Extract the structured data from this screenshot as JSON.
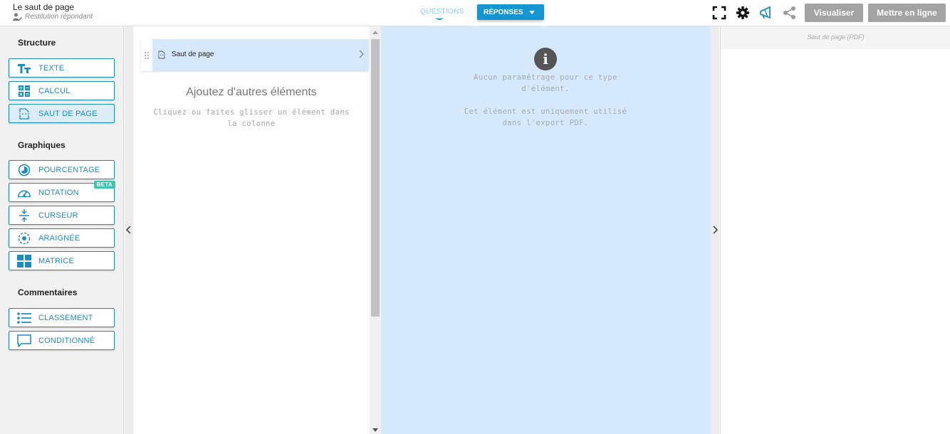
{
  "header": {
    "doc_title": "Le saut de page",
    "doc_subtitle": "Restitution répondant",
    "tab_questions": "QUESTIONS",
    "tab_reponses": "RÉPONSES",
    "visualiser": "Visualiser",
    "mettre_en_ligne": "Mettre en ligne",
    "icons": [
      "fullscreen-icon",
      "gear-icon",
      "campaign-icon",
      "share-icon"
    ]
  },
  "sidebar": {
    "structure_title": "Structure",
    "structure_items": [
      {
        "label": "TEXTE",
        "icon": "text-icon"
      },
      {
        "label": "CALCUL",
        "icon": "calculator-icon"
      },
      {
        "label": "SAUT DE PAGE",
        "icon": "page-break-icon",
        "active": true
      }
    ],
    "graphiques_title": "Graphiques",
    "graphiques_items": [
      {
        "label": "POURCENTAGE",
        "icon": "pie-icon"
      },
      {
        "label": "NOTATION",
        "icon": "gauge-icon",
        "badge": "BETA"
      },
      {
        "label": "CURSEUR",
        "icon": "slider-icon"
      },
      {
        "label": "ARAIGNÉE",
        "icon": "spider-icon"
      },
      {
        "label": "MATRICE",
        "icon": "matrix-icon"
      }
    ],
    "commentaires_title": "Commentaires",
    "commentaires_items": [
      {
        "label": "CLASSEMENT",
        "icon": "list-icon"
      },
      {
        "label": "CONDITIONNÉ",
        "icon": "comment-icon"
      }
    ]
  },
  "column": {
    "item_label": "Saut de page",
    "add_title": "Ajoutez d'autres éléments",
    "add_desc": "Cliquez ou faites glisser un élément dans la colonne"
  },
  "settings": {
    "info_line1": "Aucun paramétrage pour ce type d'élément.",
    "info_line2": "Cet élément est uniquement utilisé dans l'export PDF."
  },
  "preview": {
    "header": "Saut de page (PDF)"
  },
  "colors": {
    "accent": "#1d8cc2",
    "button_blue": "#1596d2",
    "settings_bg": "#d6e8fb",
    "beta": "#3cc6ae"
  }
}
